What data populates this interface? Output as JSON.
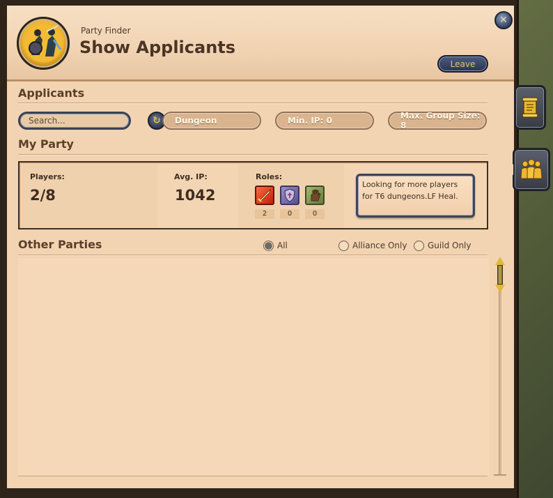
{
  "header": {
    "subtitle": "Party Finder",
    "title": "Show Applicants",
    "leave_label": "Leave",
    "close_glyph": "✕"
  },
  "applicants": {
    "section_title": "Applicants",
    "search_placeholder": "Search...",
    "refresh_glyph": "↻",
    "filters": [
      {
        "label": "Dungeon"
      },
      {
        "label": "Min. IP: 0"
      },
      {
        "label": "Max. Group Size: 8"
      }
    ]
  },
  "my_party": {
    "section_title": "My Party",
    "players_label": "Players:",
    "players_value": "2/8",
    "avg_ip_label": "Avg. IP:",
    "avg_ip_value": "1042",
    "roles_label": "Roles:",
    "roles": [
      {
        "name": "dps",
        "icon": "sword-icon",
        "count": "2"
      },
      {
        "name": "tank",
        "icon": "shield-icon",
        "count": "0"
      },
      {
        "name": "healer",
        "icon": "hand-icon",
        "count": "0"
      }
    ],
    "description": "Looking for more players for T6 dungeons.LF Heal."
  },
  "other_parties": {
    "section_title": "Other Parties",
    "radio_options": [
      {
        "label": "All",
        "selected": true
      },
      {
        "label": "Alliance Only",
        "selected": false
      },
      {
        "label": "Guild Only",
        "selected": false
      }
    ]
  },
  "colors": {
    "panel_bg": "#f3d4b2",
    "header_bg": "#f1d3b2",
    "frame_dark": "#2f2419",
    "text_dark": "#4a3526",
    "leave_text": "#e2c66b",
    "dps": "#c21e0f",
    "tank": "#58508e",
    "heal": "#66793a",
    "accent_gold": "#e0b93a"
  }
}
